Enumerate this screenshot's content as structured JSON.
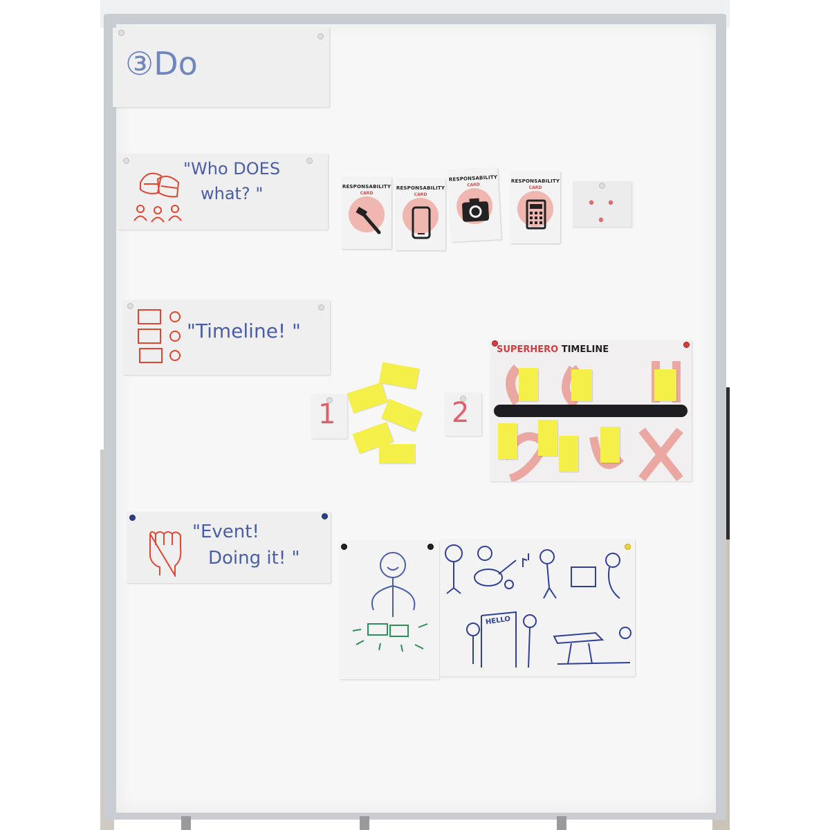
{
  "board": {
    "heading": "③Do",
    "sections": [
      {
        "id": "who",
        "text_line1": "\"Who DOES",
        "text_line2": "what? \""
      },
      {
        "id": "timeline",
        "text": "\"Timeline! \""
      },
      {
        "id": "event",
        "text_line1": "\"Event!",
        "text_line2": "Doing it! \""
      }
    ],
    "cards": [
      {
        "title": "RESPONSABILITY",
        "sub": "CARD",
        "icon": "hammer-icon"
      },
      {
        "title": "RESPONSABILITY",
        "sub": "CARD",
        "icon": "phone-icon"
      },
      {
        "title": "RESPONSABILITY",
        "sub": "CARD",
        "icon": "camera-icon"
      },
      {
        "title": "RESPONSABILITY",
        "sub": "CARD",
        "icon": "calculator-icon"
      }
    ],
    "more_card": "• • •",
    "step_numbers": [
      "1",
      "2"
    ],
    "superhero_timeline": {
      "title_red": "SUPERHERO",
      "title_black": "TIMELINE"
    },
    "drawing_label": "HELLO"
  },
  "colors": {
    "marker_blue": "#4a5ea8",
    "marker_red": "#e0606a",
    "sticky_yellow": "#f5ef4a",
    "card_pink": "#efb7b0"
  }
}
